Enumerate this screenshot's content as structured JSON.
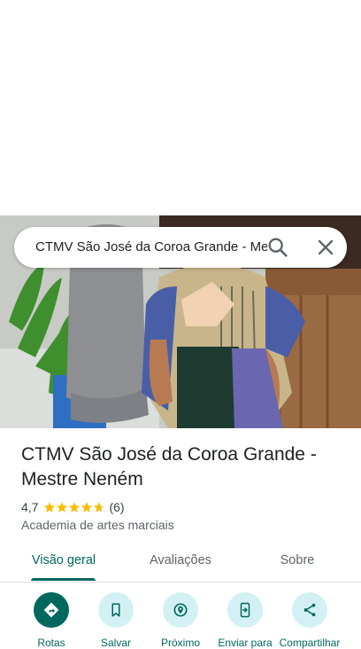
{
  "search": {
    "query": "CTMV São José da Coroa Grande - Mestre Neném"
  },
  "place": {
    "title": "CTMV São José da Coroa Grande - Mestre Neném",
    "rating": "4,7",
    "rating_value": 4.7,
    "review_count": "(6)",
    "category": "Academia de artes marciais"
  },
  "tabs": [
    {
      "label": "Visão geral",
      "active": true
    },
    {
      "label": "Avaliações",
      "active": false
    },
    {
      "label": "Sobre",
      "active": false
    }
  ],
  "actions": [
    {
      "label": "Rotas",
      "icon": "directions-icon"
    },
    {
      "label": "Salvar",
      "icon": "bookmark-icon"
    },
    {
      "label": "Próximo",
      "icon": "nearby-icon"
    },
    {
      "label": "Enviar para",
      "icon": "send-to-phone-icon"
    },
    {
      "label": "Compartilhar",
      "icon": "share-icon"
    }
  ],
  "colors": {
    "accent": "#00685e",
    "accent_light": "#d3f1f4",
    "star": "#fbbc04"
  }
}
